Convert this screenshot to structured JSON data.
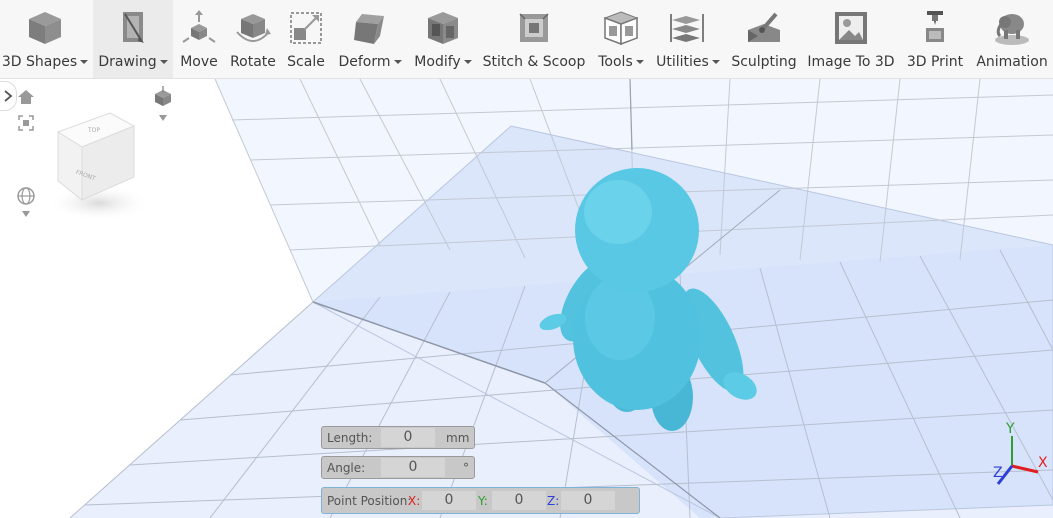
{
  "toolbar": {
    "items": [
      {
        "label": "3D Shapes",
        "dropdown": true,
        "icon": "cube-icon"
      },
      {
        "label": "Drawing",
        "dropdown": true,
        "icon": "drawing-pen-icon",
        "active": true
      },
      {
        "label": "Move",
        "dropdown": false,
        "icon": "move-arrows-icon"
      },
      {
        "label": "Rotate",
        "dropdown": false,
        "icon": "rotate-cube-icon"
      },
      {
        "label": "Scale",
        "dropdown": false,
        "icon": "scale-box-icon"
      },
      {
        "label": "Deform",
        "dropdown": true,
        "icon": "deform-shape-icon"
      },
      {
        "label": "Modify",
        "dropdown": true,
        "icon": "modify-box-icon"
      },
      {
        "label": "Stitch & Scoop",
        "dropdown": false,
        "icon": "stitch-scoop-icon"
      },
      {
        "label": "Tools",
        "dropdown": true,
        "icon": "tools-box-icon"
      },
      {
        "label": "Utilities",
        "dropdown": true,
        "icon": "utilities-layers-icon"
      },
      {
        "label": "Sculpting",
        "dropdown": false,
        "icon": "sculpting-tool-icon"
      },
      {
        "label": "Image To 3D",
        "dropdown": false,
        "icon": "image-to-3d-icon"
      },
      {
        "label": "3D Print",
        "dropdown": false,
        "icon": "printer-3d-icon"
      },
      {
        "label": "Animation",
        "dropdown": false,
        "icon": "animation-elephant-icon"
      }
    ]
  },
  "view_cube": {
    "top": "TOP",
    "front": "FRONT"
  },
  "axes": {
    "x": "X",
    "y": "Y",
    "z": "Z",
    "x_color": "#e02020",
    "y_color": "#2e9e2e",
    "z_color": "#2c3fd6"
  },
  "model_color": "#5ccbe6",
  "inputs": {
    "length": {
      "label": "Length:",
      "value": "0",
      "unit": "mm"
    },
    "angle": {
      "label": "Angle:",
      "value": "0",
      "unit": "°"
    },
    "point_position": {
      "label": "Point Position:",
      "x_label": "X:",
      "x": "0",
      "y_label": "Y:",
      "y": "0",
      "z_label": "Z:",
      "z": "0"
    }
  }
}
